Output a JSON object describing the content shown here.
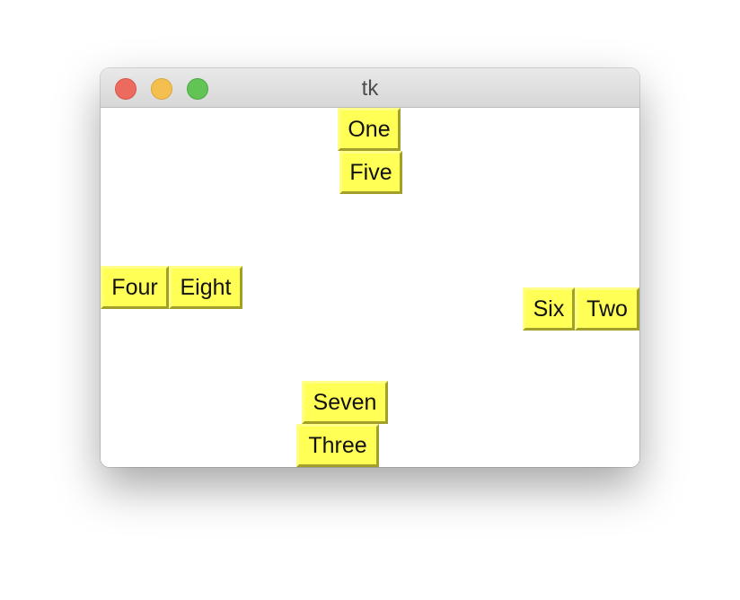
{
  "window": {
    "title": "tk",
    "controls": {
      "close_color": "#ed6a5e",
      "minimize_color": "#f5bf4f",
      "maximize_color": "#61c454"
    }
  },
  "labels": {
    "one": "One",
    "two": "Two",
    "three": "Three",
    "four": "Four",
    "five": "Five",
    "six": "Six",
    "seven": "Seven",
    "eight": "Eight"
  },
  "colors": {
    "label_background": "#ffff55",
    "label_border_light": "#ffff88",
    "label_border_dark": "#a0a02a",
    "canvas_background": "#ffffff"
  }
}
